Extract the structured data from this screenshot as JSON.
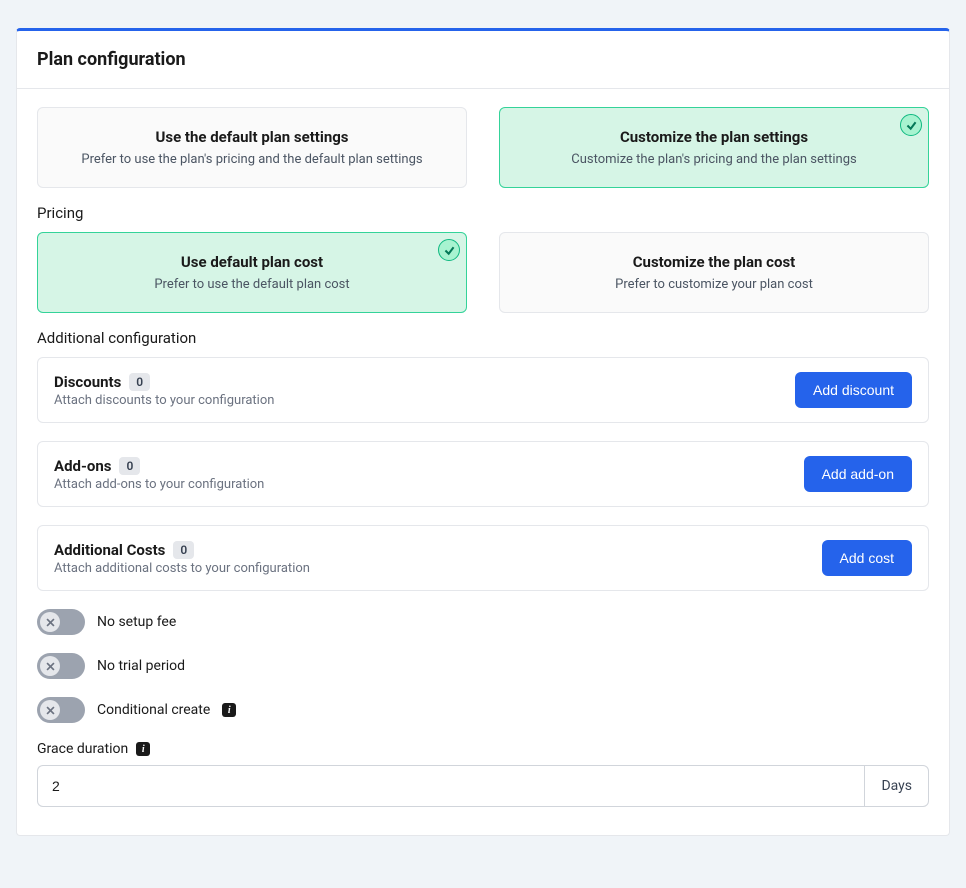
{
  "header": {
    "title": "Plan configuration"
  },
  "planOptions": {
    "default": {
      "title": "Use the default plan settings",
      "desc": "Prefer to use the plan's pricing and the default plan settings",
      "selected": false
    },
    "customize": {
      "title": "Customize the plan settings",
      "desc": "Customize the plan's pricing and the plan settings",
      "selected": true
    }
  },
  "pricing": {
    "label": "Pricing",
    "default": {
      "title": "Use default plan cost",
      "desc": "Prefer to use the default plan cost",
      "selected": true
    },
    "customize": {
      "title": "Customize the plan cost",
      "desc": "Prefer to customize your plan cost",
      "selected": false
    }
  },
  "additional": {
    "label": "Additional configuration",
    "discounts": {
      "title": "Discounts",
      "count": "0",
      "desc": "Attach discounts to your configuration",
      "button": "Add discount"
    },
    "addons": {
      "title": "Add-ons",
      "count": "0",
      "desc": "Attach add-ons to your configuration",
      "button": "Add add-on"
    },
    "costs": {
      "title": "Additional Costs",
      "count": "0",
      "desc": "Attach additional costs to your configuration",
      "button": "Add cost"
    }
  },
  "toggles": {
    "setupFee": {
      "label": "No setup fee"
    },
    "trialPeriod": {
      "label": "No trial period"
    },
    "conditionalCreate": {
      "label": "Conditional create"
    }
  },
  "grace": {
    "label": "Grace duration",
    "value": "2",
    "unit": "Days"
  }
}
